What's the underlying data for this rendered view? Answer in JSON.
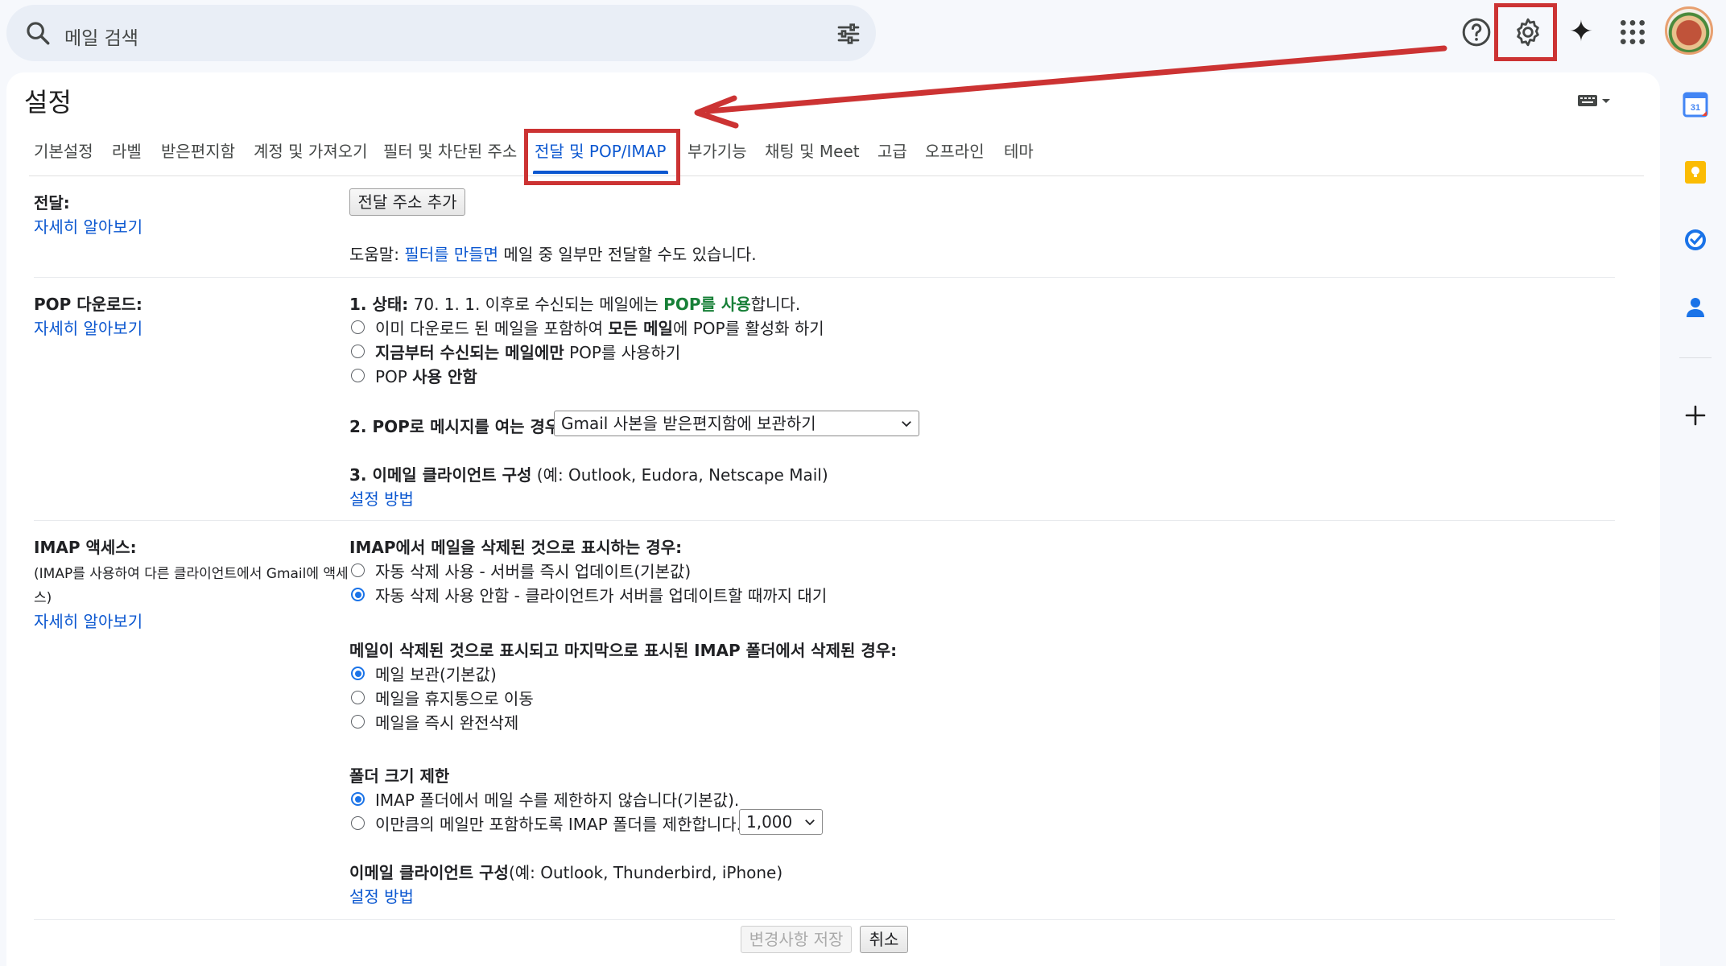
{
  "topbar": {
    "search_placeholder": "메일 검색"
  },
  "page": {
    "title": "설정"
  },
  "tabs": [
    {
      "label": "기본설정"
    },
    {
      "label": "라벨"
    },
    {
      "label": "받은편지함"
    },
    {
      "label": "계정 및 가져오기"
    },
    {
      "label": "필터 및 차단된 주소"
    },
    {
      "label": "전달 및 POP/IMAP",
      "active": true
    },
    {
      "label": "부가기능"
    },
    {
      "label": "채팅 및 Meet"
    },
    {
      "label": "고급"
    },
    {
      "label": "오프라인"
    },
    {
      "label": "테마"
    }
  ],
  "forwarding": {
    "label": "전달:",
    "learn_more": "자세히 알아보기",
    "add_button": "전달 주소 추가",
    "help_prefix": "도움말: ",
    "help_link": "필터를 만들면",
    "help_suffix": " 메일 중 일부만 전달할 수도 있습니다."
  },
  "pop": {
    "label": "POP 다운로드:",
    "learn_more": "자세히 알아보기",
    "status_label": "1. 상태:",
    "status_text": " 70. 1. 1. 이후로 수신되는 메일에는 ",
    "status_highlight": "POP를 사용",
    "status_end": "합니다.",
    "options": [
      {
        "pre": "이미 다운로드 된 메일을 포함하여 ",
        "bold": "모든 메일",
        "post": "에 POP를 활성화 하기",
        "selected": false
      },
      {
        "pre": "",
        "bold": "지금부터 수신되는 메일에만",
        "post": " POP를 사용하기",
        "selected": false
      },
      {
        "pre": "POP ",
        "bold": "사용 안함",
        "post": "",
        "selected": false
      }
    ],
    "when_label": "2. POP로 메시지를 여는 경우",
    "when_select": "Gmail 사본을 받은편지함에 보관하기",
    "client_label": "3. 이메일 클라이언트 구성",
    "client_examples": " (예: Outlook, Eudora, Netscape Mail)",
    "setup_link": "설정 방법"
  },
  "imap": {
    "label": "IMAP 액세스:",
    "desc_line1": "(IMAP를 사용하여 다른 클라이언트에서 Gmail에 액세",
    "desc_line2": "스)",
    "learn_more": "자세히 알아보기",
    "delete_heading": "IMAP에서 메일을 삭제된 것으로 표시하는 경우:",
    "delete_options": [
      {
        "label": "자동 삭제 사용 - 서버를 즉시 업데이트(기본값)",
        "selected": false
      },
      {
        "label": "자동 삭제 사용 안함 - 클라이언트가 서버를 업데이트할 때까지 대기",
        "selected": true
      }
    ],
    "expunge_heading": "메일이 삭제된 것으로 표시되고 마지막으로 표시된 IMAP 폴더에서 삭제된 경우:",
    "expunge_options": [
      {
        "label": "메일 보관(기본값)",
        "selected": true
      },
      {
        "label": "메일을 휴지통으로 이동",
        "selected": false
      },
      {
        "label": "메일을 즉시 완전삭제",
        "selected": false
      }
    ],
    "folder_heading": "폴더 크기 제한",
    "folder_options": [
      {
        "label": "IMAP 폴더에서 메일 수를 제한하지 않습니다(기본값).",
        "selected": true
      },
      {
        "label": "이만큼의 메일만 포함하도록 IMAP 폴더를 제한합니다.",
        "selected": false
      }
    ],
    "folder_limit_select": "1,000",
    "client_label": "이메일 클라이언트 구성",
    "client_examples": "(예: Outlook, Thunderbird, iPhone)",
    "setup_link": "설정 방법"
  },
  "footer": {
    "save_button": "변경사항 저장",
    "cancel_button": "취소"
  },
  "sidepanel": {
    "calendar_day": "31"
  },
  "colors": {
    "accent": "#0b57d0",
    "annotation": "#cc3333",
    "pop_enabled": "#188038"
  }
}
